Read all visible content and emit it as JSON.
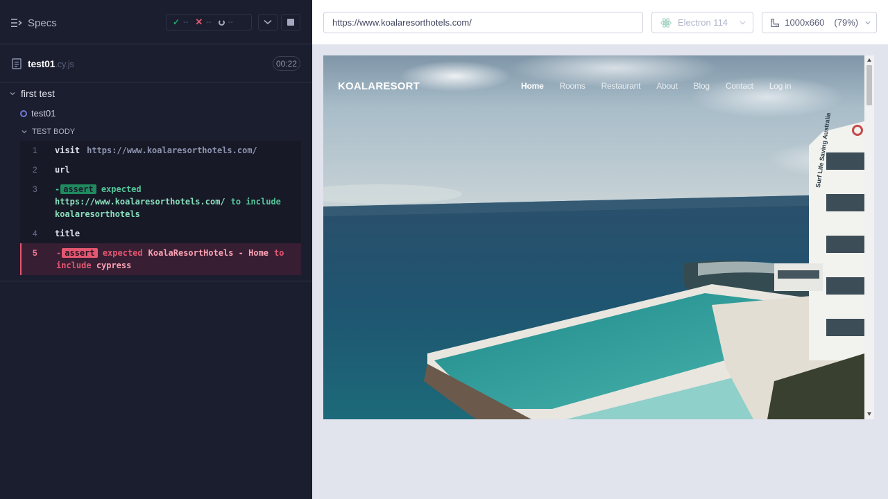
{
  "reporter": {
    "specs_label": "Specs",
    "stats": {
      "passed": "--",
      "failed": "--",
      "pending": "--"
    },
    "spec": {
      "name": "test01",
      "ext": ".cy.js",
      "duration": "00:22"
    },
    "suite_title": "first test",
    "test_title": "test01",
    "body_label": "TEST BODY",
    "commands": [
      {
        "num": "1",
        "name": "visit",
        "arg": "https://www.koalaresorthotels.com/"
      },
      {
        "num": "2",
        "name": "url"
      },
      {
        "num": "3",
        "dash": "-",
        "badge": "assert",
        "w1": "expected",
        "hl1": "https://www.koalaresorthotels.com/",
        "w2": "to include",
        "hl2": "koalaresorthotels"
      },
      {
        "num": "4",
        "name": "title"
      },
      {
        "num": "5",
        "dash": "-",
        "badge": "assert",
        "w1": "expected",
        "hl1": "KoalaResortHotels - Home",
        "w2": "to include",
        "hl2": "cypress"
      }
    ]
  },
  "aut": {
    "url": "https://www.koalaresorthotels.com/",
    "browser": "Electron 114",
    "viewport": "1000x660",
    "scale": "(79%)",
    "site": {
      "logo": "KOALARESORT",
      "nav": [
        "Home",
        "Rooms",
        "Restaurant",
        "About",
        "Blog",
        "Contact",
        "Log in"
      ],
      "hero_banner_text": "Surf Life Saving Australia"
    }
  },
  "colors": {
    "reporter_bg": "#1b1e2e",
    "pass": "#1fa971",
    "fail": "#e45770",
    "running": "#7179d6",
    "aut_bg": "#e1e3ed"
  }
}
